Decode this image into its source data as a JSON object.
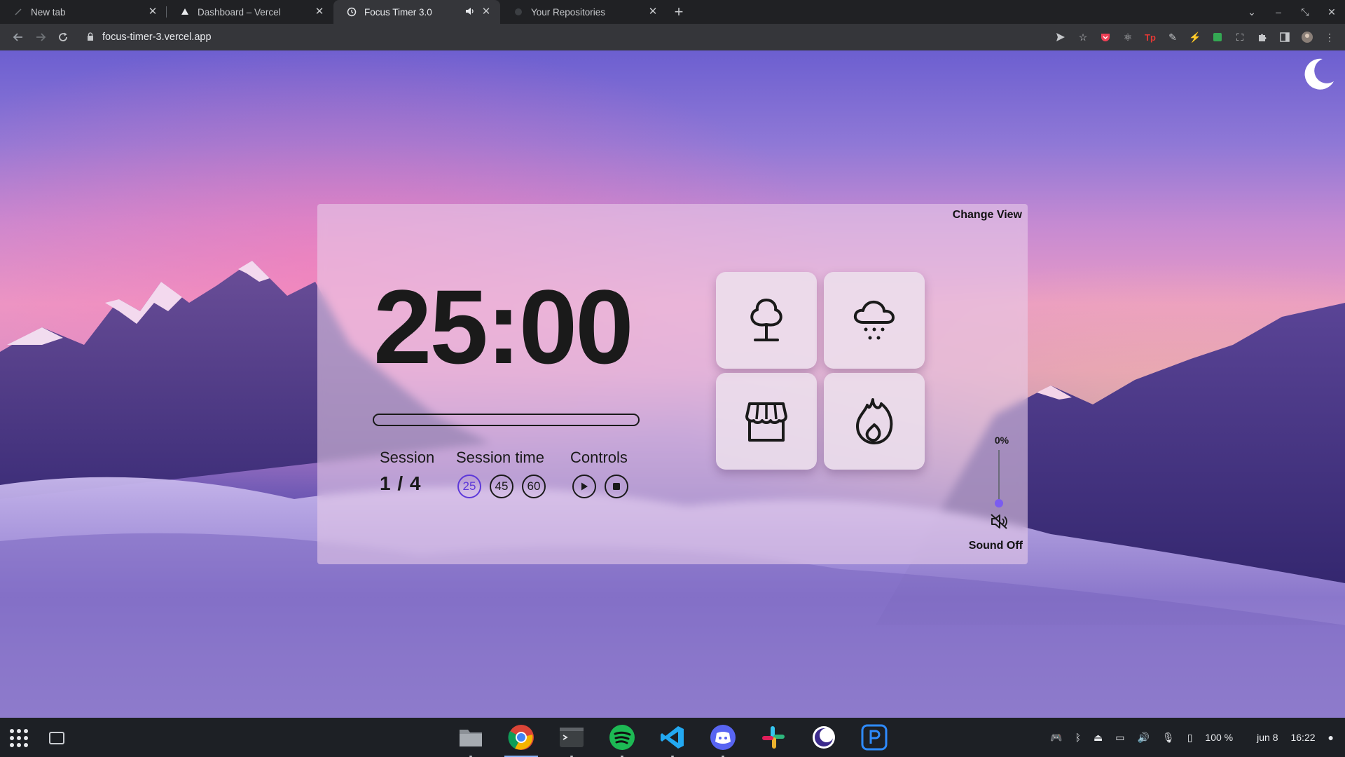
{
  "browser": {
    "tabs": [
      {
        "title": "New tab",
        "favicon": "newtab-icon"
      },
      {
        "title": "Dashboard – Vercel",
        "favicon": "vercel-icon"
      },
      {
        "title": "Focus Timer 3.0",
        "favicon": "clock-icon",
        "active": true,
        "audio": true
      },
      {
        "title": "Your Repositories",
        "favicon": "github-icon"
      }
    ],
    "url": "focus-timer-3.vercel.app"
  },
  "timer": {
    "change_view": "Change View",
    "time": "25:00",
    "progress": 0,
    "session_label": "Session",
    "session_value": "1 / 4",
    "session_time_label": "Session time",
    "session_time_options": [
      "25",
      "45",
      "60"
    ],
    "session_time_selected": "25",
    "controls_label": "Controls",
    "sounds": [
      "tree-icon",
      "rain-cloud-icon",
      "store-icon",
      "fire-icon"
    ],
    "volume_label": "0%",
    "volume": 0,
    "sound_status": "Sound Off"
  },
  "colors": {
    "accent": "#5d38d9",
    "slider": "#7b5cf0"
  },
  "shelf": {
    "apps": [
      "files",
      "chrome",
      "terminal",
      "spotify",
      "vscode",
      "discord",
      "slack",
      "focus-app",
      "p-app"
    ],
    "battery": "100 %",
    "date": "jun 8",
    "time": "16:22"
  }
}
